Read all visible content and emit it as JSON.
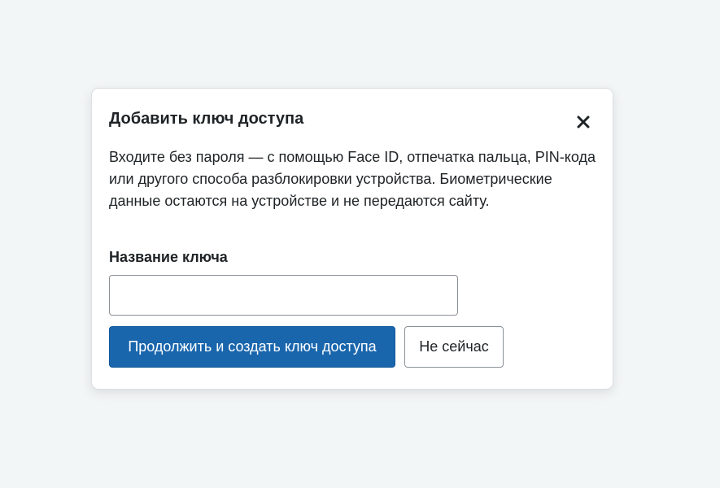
{
  "dialog": {
    "title": "Добавить ключ доступа",
    "close_icon": "close-icon",
    "description": "Входите без пароля — с помощью Face ID, отпечатка пальца, PIN-кода или другого способа разблокировки устройства. Биометрические данные остаются на устройстве и не передаются сайту.",
    "key_name_label": "Название ключа",
    "key_name_value": "",
    "key_name_placeholder": "",
    "primary_button_label": "Продолжить и создать ключ доступа",
    "secondary_button_label": "Не сейчас"
  },
  "colors": {
    "page_background": "#f3f6f7",
    "primary_button": "#1a66ad",
    "text": "#1f2326"
  }
}
